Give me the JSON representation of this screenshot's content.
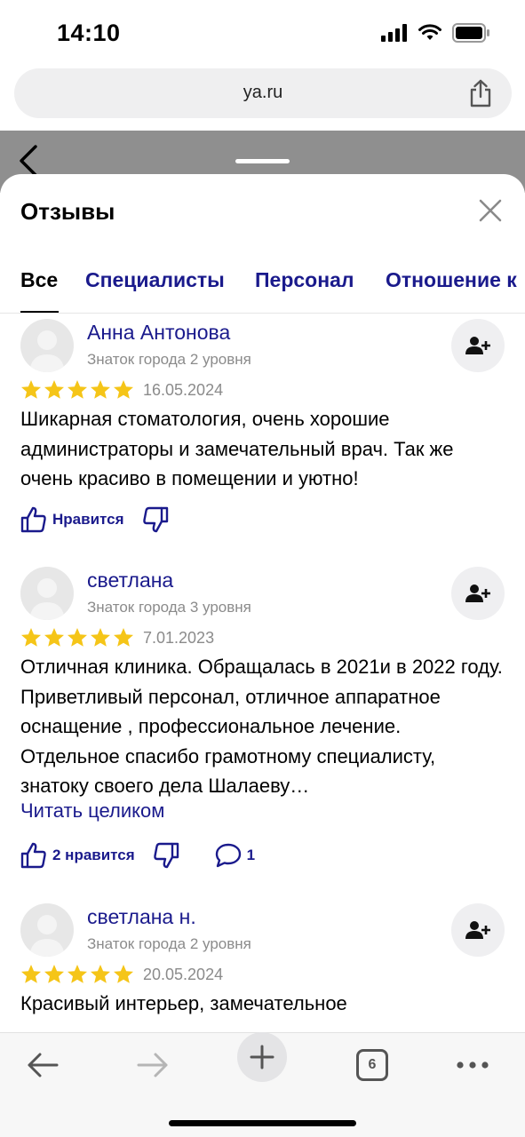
{
  "status_bar": {
    "time": "14:10"
  },
  "browser": {
    "url": "ya.ru",
    "tabs_count": "6"
  },
  "sheet": {
    "title": "Отзывы",
    "tabs": [
      {
        "label": "Все",
        "active": true
      },
      {
        "label": "Специалисты",
        "active": false
      },
      {
        "label": "Персонал",
        "active": false
      },
      {
        "label": "Отношение к",
        "active": false
      }
    ]
  },
  "reviews": [
    {
      "author": "Анна Антонова",
      "rank": "Знаток города 2 уровня",
      "rating": 5,
      "date": "16.05.2024",
      "text": "Шикарная стоматология, очень хорошие администраторы и замечательный врач. Так же очень красиво в помещении и уютно!",
      "like_label": "Нравится"
    },
    {
      "author": "светлана",
      "rank": "Знаток города 3 уровня",
      "rating": 5,
      "date": "7.01.2023",
      "text": "Отличная клиника. Обращалась в 2021и в 2022 году. Приветливый персонал, отличное аппаратное оснащение , профессиональное лечение. Отдельное спасибо грамотному специалисту, знатоку своего дела Шалаеву…",
      "read_more": "Читать целиком",
      "like_label": "2 нравится",
      "comments": "1"
    },
    {
      "author": "светлана н.",
      "rank": "Знаток города 2 уровня",
      "rating": 5,
      "date": "20.05.2024",
      "text": "Красивый интерьер, замечательное"
    }
  ],
  "colors": {
    "link": "#1a1a8c",
    "star": "#f5c518",
    "muted": "#8b8b8b"
  }
}
